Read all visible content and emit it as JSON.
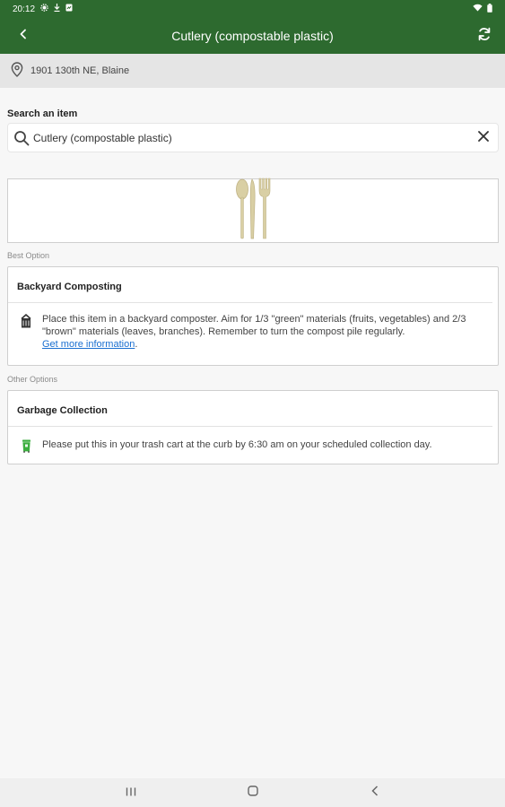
{
  "status_bar": {
    "time": "20:12"
  },
  "app_bar": {
    "title": "Cutlery (compostable plastic)",
    "back_icon": "chevron-left-icon",
    "refresh_icon": "refresh-icon"
  },
  "location": {
    "icon": "location-pin-icon",
    "address": "1901 130th NE, Blaine"
  },
  "search": {
    "label": "Search an item",
    "value": "Cutlery (compostable plastic)",
    "icon": "search-icon",
    "clear_icon": "close-icon"
  },
  "item_image": {
    "icon": "cutlery-icon"
  },
  "best_option": {
    "section_label": "Best Option",
    "title": "Backyard Composting",
    "icon": "compost-bin-icon",
    "text": "Place this item in a backyard composter. Aim for 1/3 \"green\" materials (fruits, vegetables) and 2/3 \"brown\" materials (leaves, branches). Remember to turn the compost pile regularly.",
    "link_text": "Get more information"
  },
  "other_options": {
    "section_label": "Other Options",
    "items": [
      {
        "title": "Garbage Collection",
        "icon": "trash-cart-icon",
        "text": "Please put this in your trash cart at the curb by 6:30 am on your scheduled collection day."
      }
    ]
  },
  "colors": {
    "primary": "#2d6a2f",
    "link": "#1a6fd0",
    "trash_icon": "#3cae3f"
  }
}
